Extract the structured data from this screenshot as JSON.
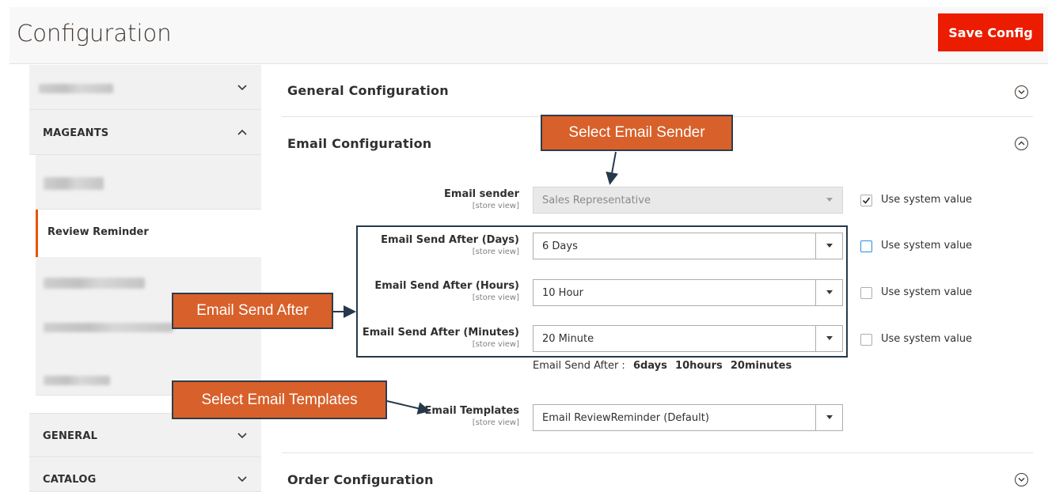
{
  "header": {
    "title": "Configuration",
    "save_label": "Save Config"
  },
  "sidebar": {
    "sections": [
      {
        "label": "MAGEANTS"
      },
      {
        "label": "GENERAL"
      },
      {
        "label": "CATALOG"
      }
    ],
    "active_item": "Review Reminder"
  },
  "main": {
    "general_section": "General Configuration",
    "email_section": "Email Configuration",
    "order_section": "Order Configuration",
    "scope_label": "[store view]",
    "fields": [
      {
        "label": "Email sender",
        "value": "Sales Representative",
        "use_system_label": "Use system value",
        "use_system": true
      },
      {
        "label": "Email Send After (Days)",
        "value": "6 Days",
        "use_system_label": "Use system value",
        "use_system": false
      },
      {
        "label": "Email Send After (Hours)",
        "value": "10 Hour",
        "use_system_label": "Use system value",
        "use_system": false
      },
      {
        "label": "Email Send After (Minutes)",
        "value": "20 Minute",
        "use_system_label": "Use system value",
        "use_system": false
      },
      {
        "label": "Email Templates",
        "value": "Email ReviewReminder (Default)"
      }
    ],
    "summary": {
      "prefix": "Email Send After :",
      "days": "6days",
      "hours": "10hours",
      "minutes": "20minutes"
    }
  },
  "callouts": {
    "sender": "Select Email Sender",
    "send_after": "Email Send After",
    "templates": "Select Email Templates"
  },
  "colors": {
    "accent": "#eb1c00",
    "callout": "#d8602a",
    "active_border": "#eb5202"
  }
}
